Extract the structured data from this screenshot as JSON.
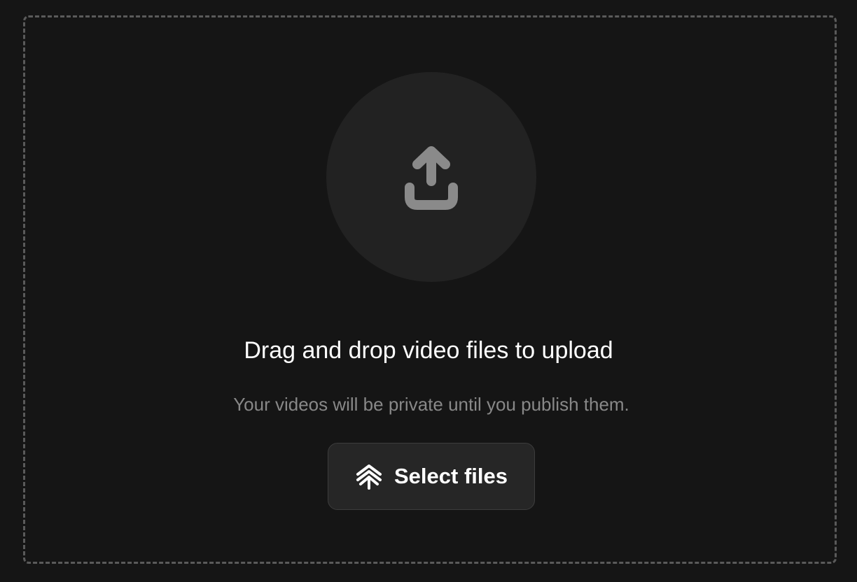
{
  "upload": {
    "title": "Drag and drop video files to upload",
    "subtitle": "Your videos will be private until you publish them.",
    "select_button_label": "Select files",
    "icons": {
      "main": "upload-icon",
      "button": "chevrons-up-icon"
    }
  },
  "colors": {
    "background": "#151515",
    "circle": "#222222",
    "icon": "#8a8a8a",
    "button_bg": "#262626",
    "dashed_border": "#5a5a5a"
  }
}
